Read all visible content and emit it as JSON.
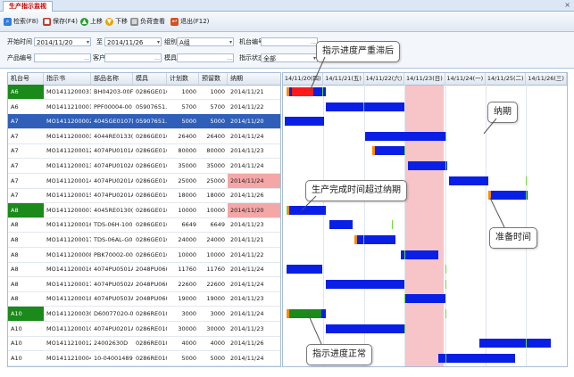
{
  "tab": {
    "title": "生产指示监视"
  },
  "toolbar": {
    "search": "检索(F8)",
    "save": "保存(F4)",
    "up": "上移",
    "down": "下移",
    "load": "负荷查看",
    "exit": "退出(F12)"
  },
  "filters": {
    "start_time_label": "开始时间",
    "start_time_value": "2014/11/20",
    "to_label": "至",
    "end_time_value": "2014/11/26",
    "group_label": "组别",
    "group_value": "A组",
    "machine_label": "机台编号",
    "product_label": "产品编号",
    "customer_label": "客户",
    "mold_label": "模具",
    "status_label": "指示状态",
    "status_value": "全部"
  },
  "grid": {
    "columns": [
      "机台号",
      "指示书",
      "部品名称",
      "模具",
      "计划数",
      "预留数",
      "纳期"
    ],
    "rows": [
      {
        "machine": "A6",
        "order": "MO1411200031",
        "part": "BH04203-00F",
        "mold": "0286GE0107",
        "plan": "1000",
        "reserve": "1000",
        "due": "2014/11/21"
      },
      {
        "machine": "A6",
        "order": "MO1411210001",
        "part": "PPF00004-00",
        "mold": "05907651...",
        "plan": "5700",
        "reserve": "5700",
        "due": "2014/11/22"
      },
      {
        "machine": "A7",
        "order": "MO1411200002",
        "part": "4045GE0107(...",
        "mold": "05907651...",
        "plan": "5000",
        "reserve": "5000",
        "due": "2014/11/20"
      },
      {
        "machine": "A7",
        "order": "MO1411200003",
        "part": "4044RE0133(...",
        "mold": "0286GE0104",
        "plan": "26400",
        "reserve": "26400",
        "due": "2014/11/24"
      },
      {
        "machine": "A7",
        "order": "MO1411200012",
        "part": "4074PU0101A...",
        "mold": "0286GE0104",
        "plan": "80000",
        "reserve": "80000",
        "due": "2014/11/23"
      },
      {
        "machine": "A7",
        "order": "MO1411200013",
        "part": "4074PU0102A...",
        "mold": "0286GE0104",
        "plan": "35000",
        "reserve": "35000",
        "due": "2014/11/24"
      },
      {
        "machine": "A7",
        "order": "MO1411200014",
        "part": "4074PU0201A...",
        "mold": "0286GE0104",
        "plan": "25000",
        "reserve": "25000",
        "due": "2014/11/24"
      },
      {
        "machine": "A7",
        "order": "MO1411200015",
        "part": "4074PU0201A...",
        "mold": "0286GE0104",
        "plan": "18000",
        "reserve": "18000",
        "due": "2014/11/26"
      },
      {
        "machine": "A8",
        "order": "MO1411200001",
        "part": "4045RE0130(...",
        "mold": "0286GE0105",
        "plan": "10000",
        "reserve": "10000",
        "due": "2014/11/20"
      },
      {
        "machine": "A8",
        "order": "MO1411200016",
        "part": "TDS-06H-1001X",
        "mold": "0286GE0105",
        "plan": "6649",
        "reserve": "6649",
        "due": "2014/11/23"
      },
      {
        "machine": "A8",
        "order": "MO1411200017",
        "part": "TDS-06AL-G0...",
        "mold": "0286GE0107",
        "plan": "24000",
        "reserve": "24000",
        "due": "2014/11/21"
      },
      {
        "machine": "A8",
        "order": "MO1411200008",
        "part": "PBK70002-00",
        "mold": "0286GE0105",
        "plan": "10000",
        "reserve": "10000",
        "due": "2014/11/22"
      },
      {
        "machine": "A8",
        "order": "MO1411200016",
        "part": "4074PU0501A...",
        "mold": "2048PU0605",
        "plan": "11760",
        "reserve": "11760",
        "due": "2014/11/24"
      },
      {
        "machine": "A8",
        "order": "MO1411200017",
        "part": "4074PU0502A...",
        "mold": "2048PU0605",
        "plan": "22600",
        "reserve": "22600",
        "due": "2014/11/24"
      },
      {
        "machine": "A8",
        "order": "MO1411200018",
        "part": "4074PU0503A...",
        "mold": "2048PU0605",
        "plan": "19000",
        "reserve": "19000",
        "due": "2014/11/23"
      },
      {
        "machine": "A10",
        "order": "MO1411200030",
        "part": "D60077020-01",
        "mold": "0286RE0103",
        "plan": "3000",
        "reserve": "3000",
        "due": "2014/11/24"
      },
      {
        "machine": "A10",
        "order": "MO1411200010",
        "part": "4074PU0201A...",
        "mold": "0286RE0107",
        "plan": "30000",
        "reserve": "30000",
        "due": "2014/11/23"
      },
      {
        "machine": "A10",
        "order": "MO1411210012",
        "part": "24002630D",
        "mold": "0286RE0107",
        "plan": "4000",
        "reserve": "4000",
        "due": "2014/11/26"
      },
      {
        "machine": "A10",
        "order": "MO1411210004",
        "part": "10-04001489",
        "mold": "0286RE0103",
        "plan": "5000",
        "reserve": "5000",
        "due": "2014/11/24"
      }
    ]
  },
  "gantt": {
    "days": [
      "14/11/20(四)",
      "14/11/21(五)",
      "14/11/22(六)",
      "14/11/23(日)",
      "14/11/24(一)",
      "14/11/25(二)",
      "14/11/26(三)"
    ]
  },
  "callouts": {
    "severe_delay": "指示进度严重滞后",
    "due_date": "纳期",
    "exceeds_due": "生产完成时间超过纳期",
    "prep_time": "准备时间",
    "normal_progress": "指示进度正常"
  },
  "colors": {
    "bar": "#0a1fe6",
    "prep": "#ff8a00",
    "due_tick": "#6cdc3c",
    "delayed": "#ff1a1a",
    "progress": "#1a8a1a",
    "weekend": "#f7c4c8",
    "selected_row": "#2f5fb8",
    "late_due_cell": "#f4a7a7",
    "machine_done": "#1a8a1a"
  }
}
